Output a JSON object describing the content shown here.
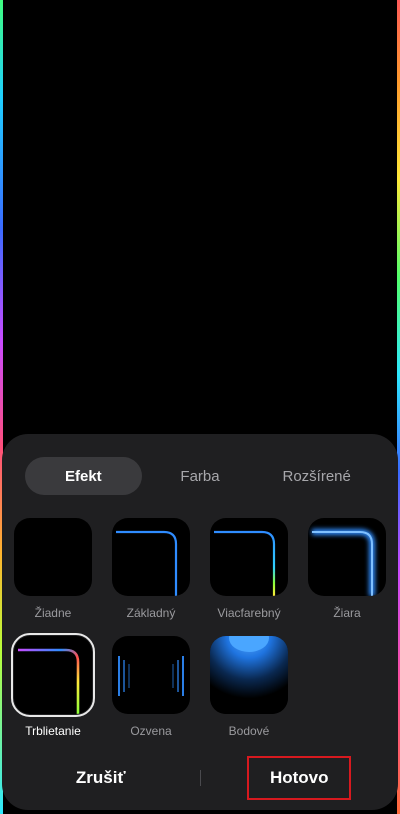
{
  "tabs": [
    {
      "label": "Efekt",
      "active": true
    },
    {
      "label": "Farba",
      "active": false
    },
    {
      "label": "Rozšírené",
      "active": false
    }
  ],
  "effects": [
    {
      "label": "Žiadne",
      "icon": "none-effect-icon",
      "selected": false
    },
    {
      "label": "Základný",
      "icon": "basic-edge-icon",
      "selected": false
    },
    {
      "label": "Viacfarebný",
      "icon": "multicolor-edge-icon",
      "selected": false
    },
    {
      "label": "Žiara",
      "icon": "glow-edge-icon",
      "selected": false
    },
    {
      "label": "Trblietanie",
      "icon": "glitter-edge-icon",
      "selected": true
    },
    {
      "label": "Ozvena",
      "icon": "echo-edge-icon",
      "selected": false
    },
    {
      "label": "Bodové",
      "icon": "spotlight-icon",
      "selected": false
    }
  ],
  "actions": {
    "cancel_label": "Zrušiť",
    "done_label": "Hotovo"
  },
  "colors": {
    "accent_blue": "#2f8cff",
    "sheet_bg": "#1f1f21",
    "highlight_border": "#d7191f"
  }
}
